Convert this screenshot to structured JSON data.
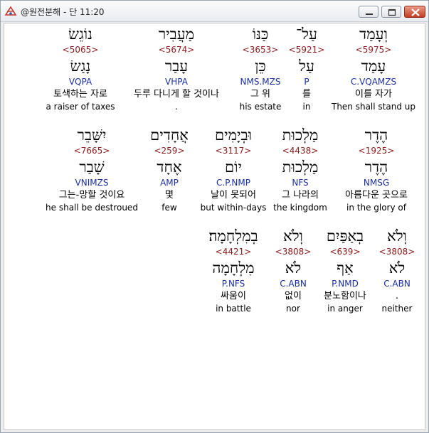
{
  "window": {
    "title": "@원전분해 - 단 11:20"
  },
  "rows": [
    {
      "words": [
        {
          "hebrew": "וְעָמַד",
          "strong": "<5975>",
          "lemma": "עָמַד",
          "morph": "C.VQAMZS",
          "korean": "이를 자가",
          "english": "Then shall stand up"
        },
        {
          "hebrew": "עַל־",
          "strong": "<5921>",
          "lemma": "עַל",
          "morph": "P",
          "korean": "를",
          "english": "in"
        },
        {
          "hebrew": "כַּנּוֹ",
          "strong": "<3653>",
          "lemma": "כֵּן",
          "morph": "NMS.MZS",
          "korean": "그 위",
          "english": "his estate"
        },
        {
          "hebrew": "מַעֲבִיר",
          "strong": "<5674>",
          "lemma": "עָבַר",
          "morph": "VHPA",
          "korean": "두루 다니게 할 것이나",
          "english": "."
        },
        {
          "hebrew": "נוֹגֵשׂ",
          "strong": "<5065>",
          "lemma": "נָגַשׂ",
          "morph": "VQPA",
          "korean": "토색하는 자로",
          "english": "a raiser of taxes"
        }
      ]
    },
    {
      "words": [
        {
          "hebrew": "הֶדֶר",
          "strong": "<1925>",
          "lemma": "הֶדֶר",
          "morph": "NMSG",
          "korean": "아름다운 곳으로",
          "english": "in the glory of"
        },
        {
          "hebrew": "מַלְכוּת",
          "strong": "<4438>",
          "lemma": "מַלְכוּת",
          "morph": "NFS",
          "korean": "그 나라의",
          "english": "the kingdom"
        },
        {
          "hebrew": "וּבְיָמִים",
          "strong": "<3117>",
          "lemma": "יוֹם",
          "morph": "C.P.NMP",
          "korean": "날이 못되어",
          "english": "but within-days"
        },
        {
          "hebrew": "אֲחָדִים",
          "strong": "<259>",
          "lemma": "אֶחָד",
          "morph": "AMP",
          "korean": "몇",
          "english": "few"
        },
        {
          "hebrew": "יִשָּׁבֵר",
          "strong": "<7665>",
          "lemma": "שָׁבַר",
          "morph": "VNIMZS",
          "korean": "그는-망할 것이요",
          "english": "he shall be destroued"
        }
      ]
    },
    {
      "words": [
        {
          "hebrew": "וְלֹא",
          "strong": "<3808>",
          "lemma": "לֹא",
          "morph": "C.ABN",
          "korean": ".",
          "english": "neither"
        },
        {
          "hebrew": "בְאַפַּיִם",
          "strong": "<639>",
          "lemma": "אַף",
          "morph": "P.NMD",
          "korean": "분노함이나",
          "english": "in anger"
        },
        {
          "hebrew": "וְלֹא",
          "strong": "<3808>",
          "lemma": "לֹא",
          "morph": "C.ABN",
          "korean": "없이",
          "english": "nor"
        },
        {
          "hebrew": "בְמִלְחָמָה׃",
          "strong": "<4421>",
          "lemma": "מִלְחָמָה",
          "morph": "P.NFS",
          "korean": "싸움이",
          "english": "in battle"
        }
      ]
    }
  ]
}
